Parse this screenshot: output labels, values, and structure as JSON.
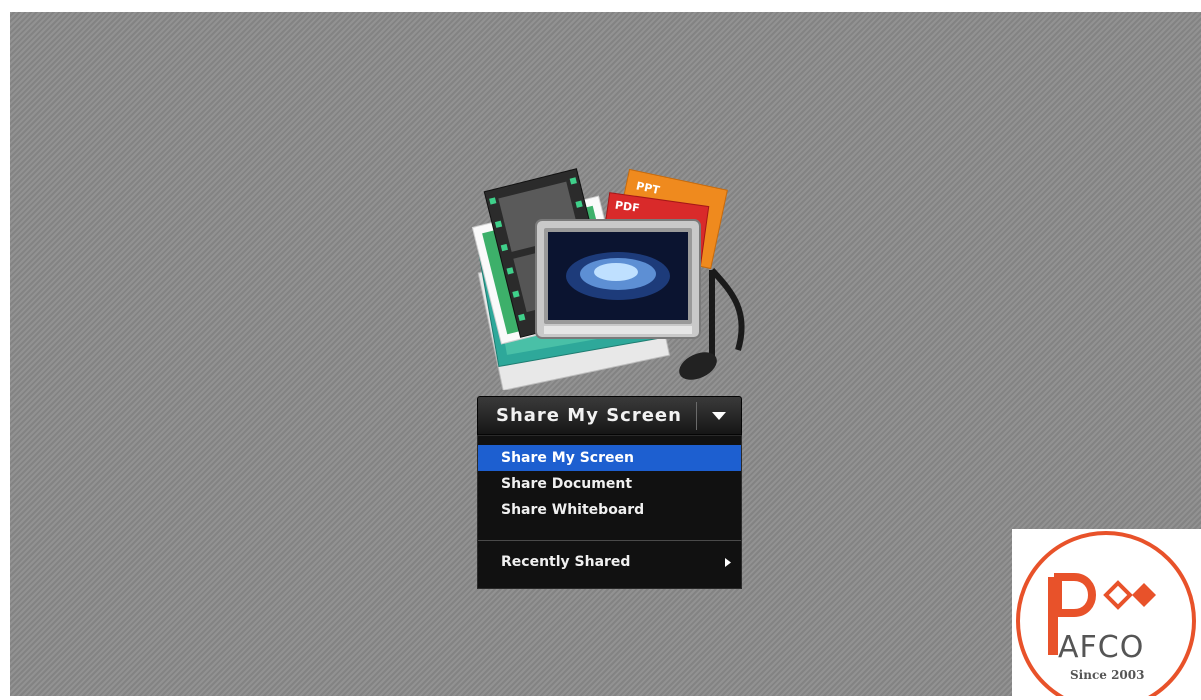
{
  "share_button": {
    "label": "Share My Screen",
    "dropdown_icon": "triangle-down-icon"
  },
  "share_menu": {
    "items": [
      {
        "label": "Share My Screen",
        "selected": true
      },
      {
        "label": "Share Document",
        "selected": false
      },
      {
        "label": "Share Whiteboard",
        "selected": false
      }
    ],
    "recently_shared": {
      "label": "Recently Shared",
      "icon": "triangle-right-icon"
    }
  },
  "illustration": {
    "ppt_label": "PPT",
    "pdf_label": "PDF",
    "icon": "media-share-icon"
  },
  "logo": {
    "letters": "AFCO",
    "tagline": "Since 2003",
    "brand_color": "#e8522a"
  },
  "colors": {
    "background": "#8a8a8a",
    "menu_bg": "#111111",
    "selected_bg": "#1d5fd0"
  }
}
